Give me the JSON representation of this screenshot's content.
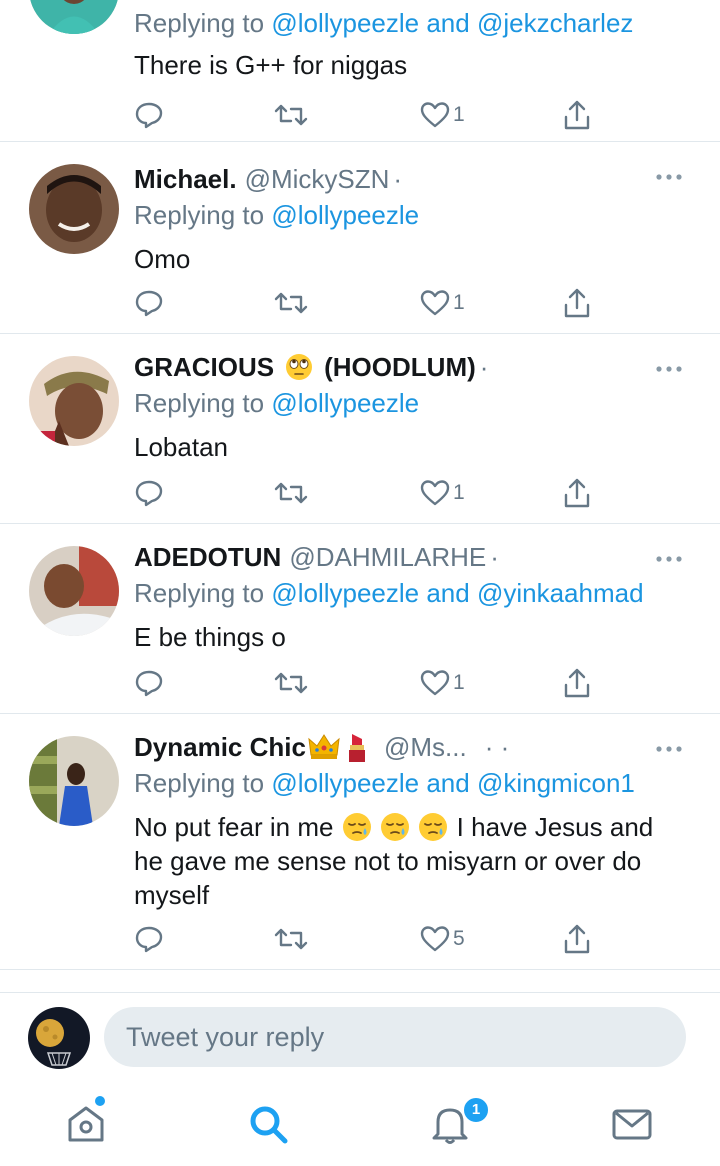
{
  "tweets": [
    {
      "name": "",
      "handle": "",
      "replying_prefix": "Replying to ",
      "mentions": [
        "@lollypeezle",
        "@jekzcharlez"
      ],
      "joiner": " and ",
      "text": "There is G++ for niggas",
      "likes": "1",
      "avatar_icon": "avatar-man-teal-shirt"
    },
    {
      "name": "Michael.",
      "handle": "@MickySZN",
      "replying_prefix": "Replying to ",
      "mentions": [
        "@lollypeezle"
      ],
      "text": "Omo",
      "likes": "1",
      "avatar_icon": "avatar-man-smiling"
    },
    {
      "name": "GRACIOUS",
      "name_suffix": "(HOODLUM)",
      "name_emoji": "eye-roll-emoji",
      "handle": "",
      "replying_prefix": "Replying to ",
      "mentions": [
        "@lollypeezle"
      ],
      "text": "Lobatan",
      "likes": "1",
      "avatar_icon": "avatar-woman-headwrap"
    },
    {
      "name": "ADEDOTUN",
      "handle": "@DAHMILARHE",
      "replying_prefix": "Replying to ",
      "mentions": [
        "@lollypeezle",
        "@yinkaahmad"
      ],
      "joiner": " and ",
      "text": "E be things o",
      "likes": "1",
      "avatar_icon": "avatar-man-white-shirt"
    },
    {
      "name": "Dynamic Chic",
      "name_emojis": [
        "crown-emoji",
        "lipstick-emoji"
      ],
      "handle": "@Ms...",
      "replying_prefix": "Replying to ",
      "mentions": [
        "@lollypeezle",
        "@kingmicon1"
      ],
      "joiner": " and ",
      "text_line1": "No put fear in me",
      "text_emoji": "sleepy-face-emoji",
      "text_rest1": " I have Jesus and",
      "text_line2": "he gave me sense not to misyarn or over do",
      "text_line3": "myself",
      "likes": "5",
      "avatar_icon": "avatar-woman-blue-dress"
    }
  ],
  "composer": {
    "placeholder": "Tweet your reply"
  },
  "nav": {
    "items": [
      "home-icon",
      "search-icon",
      "notifications-icon",
      "messages-icon"
    ],
    "notification_badge": "1",
    "active": "search"
  },
  "colors": {
    "link": "#1b95e0",
    "muted": "#657786",
    "divider": "#e1e8ed",
    "accent": "#1da1f2"
  }
}
